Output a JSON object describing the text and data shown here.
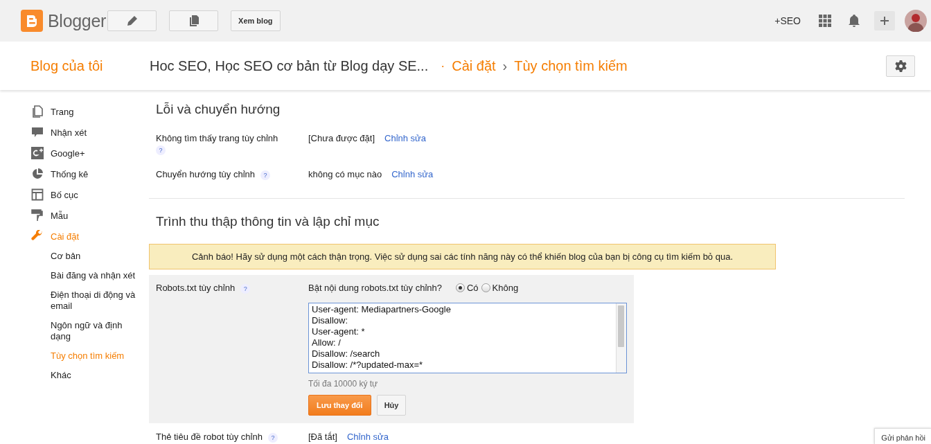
{
  "topbar": {
    "logo_text": "Blogger",
    "view_blog_button": "Xem blog",
    "profile_link": "+SEO"
  },
  "header": {
    "my_blogs": "Blog của tôi",
    "blog_title": "Hoc SEO, Học SEO cơ bản từ Blog dạy SE...",
    "separator": "·",
    "breadcrumb": [
      {
        "label": "Cài đặt"
      },
      {
        "label": "Tùy chọn tìm kiếm"
      }
    ],
    "breadcrumb_arrow": "›"
  },
  "sidebar": {
    "items": [
      {
        "label": "Trang",
        "kind": "pages",
        "selected": false
      },
      {
        "label": "Nhận xét",
        "kind": "comments",
        "selected": false
      },
      {
        "label": "Google+",
        "kind": "googleplus",
        "selected": false
      },
      {
        "label": "Thống kê",
        "kind": "stats",
        "selected": false
      },
      {
        "label": "Bố cục",
        "kind": "layout",
        "selected": false
      },
      {
        "label": "Mẫu",
        "kind": "template",
        "selected": false
      },
      {
        "label": "Cài đặt",
        "kind": "settings",
        "selected": true,
        "children": [
          {
            "label": "Cơ bản",
            "selected": false
          },
          {
            "label": "Bài đăng và nhận xét",
            "selected": false
          },
          {
            "label": "Điện thoại di động và email",
            "selected": false
          },
          {
            "label": "Ngôn ngữ và định dạng",
            "selected": false
          },
          {
            "label": "Tùy chọn tìm kiếm",
            "selected": true
          },
          {
            "label": "Khác",
            "selected": false
          }
        ]
      }
    ]
  },
  "errors_section": {
    "title": "Lỗi và chuyển hướng",
    "rows": [
      {
        "label": "Không tìm thấy trang tùy chỉnh",
        "help": "?",
        "value": "[Chưa được đặt]",
        "link": "Chỉnh sửa"
      },
      {
        "label": "Chuyển hướng tùy chỉnh",
        "help": "?",
        "value": "không có mục nào",
        "link": "Chỉnh sửa"
      }
    ]
  },
  "crawl_section": {
    "title": "Trình thu thập thông tin và lập chỉ mục",
    "warning": "Cảnh báo! Hãy sử dụng một cách thận trọng. Việc sử dụng sai các tính năng này có thể khiến blog của bạn bị công cụ tìm kiếm bỏ qua.",
    "robots": {
      "label": "Robots.txt tùy chỉnh",
      "help": "?",
      "question": "Bật nội dung robots.txt tùy chỉnh?",
      "options": [
        {
          "label": "Có",
          "selected": true
        },
        {
          "label": "Không",
          "selected": false
        }
      ],
      "content": [
        "User-agent: Mediapartners-Google",
        "Disallow:",
        "User-agent: *",
        "Allow: /",
        "Disallow: /search",
        "Disallow: /*?updated-max=*"
      ],
      "hint": "Tối đa 10000 ký tự",
      "save_button": "Lưu thay đổi",
      "cancel_button": "Hủy"
    },
    "rows": [
      {
        "label": "Thẻ tiêu đề robot tùy chỉnh",
        "help": "?",
        "value": "[Đã tắt]",
        "link": "Chỉnh sửa"
      }
    ]
  },
  "feedback_button": "Gửi phản hồi"
}
